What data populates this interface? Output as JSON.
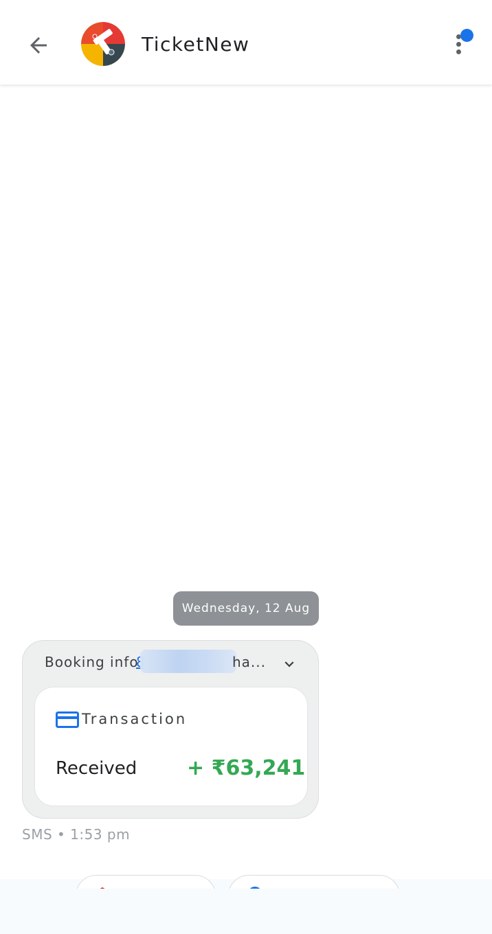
{
  "header": {
    "title": "TicketNew",
    "back_icon": "arrow-back-icon",
    "menu_icon": "more-vert-icon",
    "notification_color": "#1a73e8"
  },
  "conversation": {
    "date_separator": "Wednesday, 12 Aug",
    "message": {
      "header_prefix": "Booking info",
      "header_link": "8",
      "header_suffix": "ha...",
      "card": {
        "type": "Transaction",
        "status": "Received",
        "amount": "+ ₹63,241",
        "amount_color": "#34a853"
      },
      "meta": "SMS • 1:53 pm"
    }
  },
  "suggestions": [
    {
      "icon": "red-hex-icon",
      "color": "#d93025"
    },
    {
      "icon": "blue-circle-icon",
      "color": "#1a73e8"
    }
  ]
}
